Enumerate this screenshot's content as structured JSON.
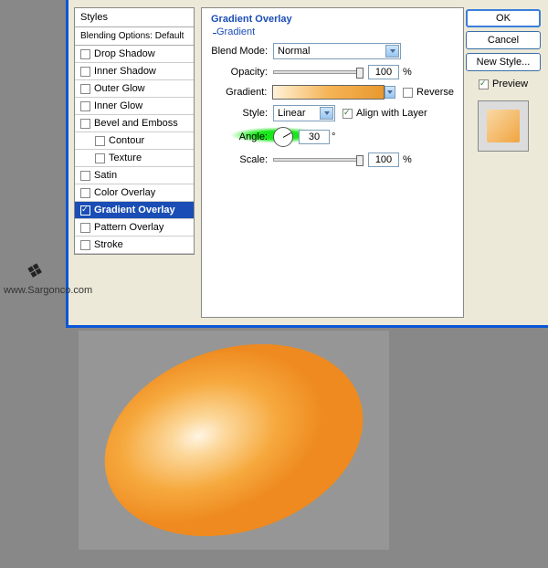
{
  "styles_panel": {
    "header": "Styles",
    "blend_header": "Blending Options: Default",
    "items": [
      {
        "label": "Drop Shadow",
        "checked": false
      },
      {
        "label": "Inner Shadow",
        "checked": false
      },
      {
        "label": "Outer Glow",
        "checked": false
      },
      {
        "label": "Inner Glow",
        "checked": false
      },
      {
        "label": "Bevel and Emboss",
        "checked": false
      },
      {
        "label": "Contour",
        "checked": false,
        "indent": true
      },
      {
        "label": "Texture",
        "checked": false,
        "indent": true
      },
      {
        "label": "Satin",
        "checked": false
      },
      {
        "label": "Color Overlay",
        "checked": false
      },
      {
        "label": "Gradient Overlay",
        "checked": true,
        "selected": true
      },
      {
        "label": "Pattern Overlay",
        "checked": false
      },
      {
        "label": "Stroke",
        "checked": false
      }
    ]
  },
  "settings": {
    "title": "Gradient Overlay",
    "subtitle": "Gradient",
    "blend_mode_label": "Blend Mode:",
    "blend_mode_value": "Normal",
    "opacity_label": "Opacity:",
    "opacity_value": "100",
    "opacity_unit": "%",
    "gradient_label": "Gradient:",
    "reverse_label": "Reverse",
    "style_label": "Style:",
    "style_value": "Linear",
    "align_label": "Align with Layer",
    "angle_label": "Angle:",
    "angle_value": "30",
    "angle_unit": "°",
    "scale_label": "Scale:",
    "scale_value": "100",
    "scale_unit": "%"
  },
  "buttons": {
    "ok": "OK",
    "cancel": "Cancel",
    "new_style": "New Style...",
    "preview": "Preview"
  },
  "watermark": "www.Sargonco.com"
}
